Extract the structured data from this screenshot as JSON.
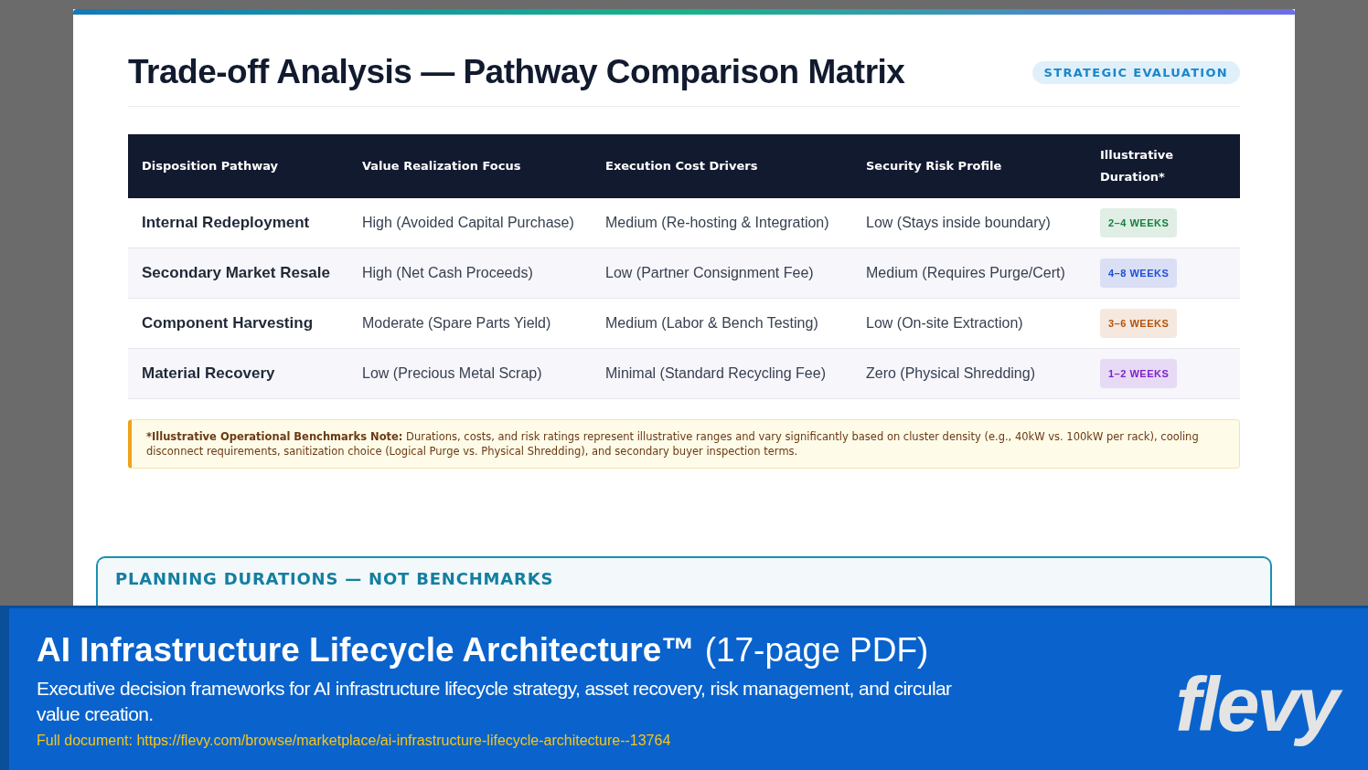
{
  "slide": {
    "title": "Trade-off Analysis — Pathway Comparison Matrix",
    "tag": "STRATEGIC EVALUATION",
    "table": {
      "columns": [
        "Disposition Pathway",
        "Value Realization Focus",
        "Execution Cost Drivers",
        "Security Risk Profile",
        "Illustrative Duration*"
      ],
      "rows": [
        {
          "pathway": "Internal Redeployment",
          "value": "High (Avoided Capital Purchase)",
          "cost": "Medium (Re-hosting & Integration)",
          "risk": "Low (Stays inside boundary)",
          "duration": "2–4 WEEKS",
          "color": "#15803d"
        },
        {
          "pathway": "Secondary Market Resale",
          "value": "High (Net Cash Proceeds)",
          "cost": "Low (Partner Consignment Fee)",
          "risk": "Medium (Requires Purge/Cert)",
          "duration": "4–8 WEEKS",
          "color": "#1d4ed8"
        },
        {
          "pathway": "Component Harvesting",
          "value": "Moderate (Spare Parts Yield)",
          "cost": "Medium (Labor & Bench Testing)",
          "risk": "Low (On-site Extraction)",
          "duration": "3–6 WEEKS",
          "color": "#b45309"
        },
        {
          "pathway": "Material Recovery",
          "value": "Low (Precious Metal Scrap)",
          "cost": "Minimal (Standard Recycling Fee)",
          "risk": "Zero (Physical Shredding)",
          "duration": "1–2 WEEKS",
          "color": "#7e22ce"
        }
      ]
    },
    "note": "***Illustrative Operational Benchmarks Note:** Durations, costs, and risk ratings represent illustrative ranges and vary significantly based on cluster density (e.g., 40kW vs. 100kW per rack), cooling disconnect requirements, sanitization choice (Logical Purge vs. Physical Shredding), and secondary buyer inspection terms.",
    "next_section": "PLANNING DURATIONS — NOT BENCHMARKS"
  },
  "banner": {
    "title": "AI Infrastructure Lifecycle Architecture™",
    "title_suffix": "(17-page PDF)",
    "description": "Executive decision frameworks for AI infrastructure lifecycle strategy, asset recovery, risk management, and circular value creation.",
    "link": "Full document: https://flevy.com/browse/marketplace/ai-infrastructure-lifecycle-architecture--13764",
    "logo": "flevy"
  }
}
